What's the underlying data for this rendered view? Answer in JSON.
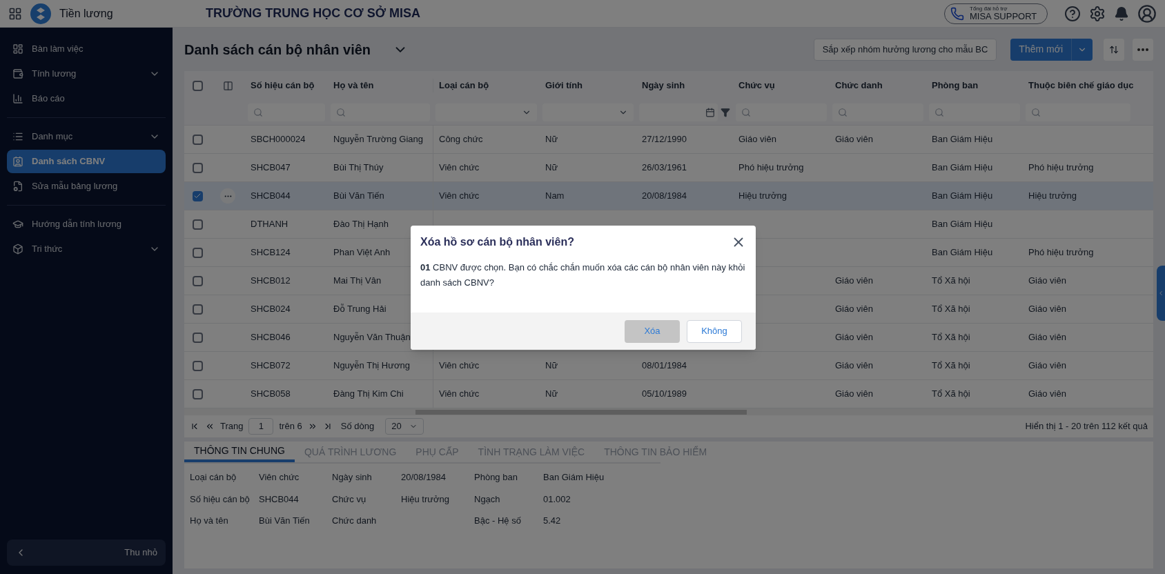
{
  "app": {
    "name": "Tiền lương",
    "school": "TRƯỜNG TRUNG HỌC CƠ SỞ MISA",
    "support_caption": "Tổng đài hỗ trợ",
    "support_label": "MISA SUPPORT"
  },
  "sidebar": {
    "groups": [
      [
        {
          "label": "Bàn làm việc",
          "selected": false,
          "expandable": false
        },
        {
          "label": "Tính lương",
          "selected": false,
          "expandable": true
        },
        {
          "label": "Báo cáo",
          "selected": false,
          "expandable": false
        }
      ],
      [
        {
          "label": "Danh mục",
          "selected": false,
          "expandable": true
        },
        {
          "label": "Danh sách CBNV",
          "selected": true,
          "expandable": false
        },
        {
          "label": "Sửa mẫu bảng lương",
          "selected": false,
          "expandable": false
        }
      ],
      [
        {
          "label": "Hướng dẫn tính lương",
          "selected": false,
          "expandable": false
        },
        {
          "label": "Tri thức",
          "selected": false,
          "expandable": true
        }
      ]
    ],
    "collapse_label": "Thu nhỏ"
  },
  "page": {
    "title": "Danh sách cán bộ nhân viên",
    "sort_button": "Sắp xếp nhóm hưởng lương cho mẫu BC",
    "add_button": "Thêm mới"
  },
  "table": {
    "all_selected": false,
    "columns": [
      {
        "label": "Số hiệu cán bộ",
        "kind": "search"
      },
      {
        "label": "Họ và tên",
        "kind": "search"
      },
      {
        "label": "Loại cán bộ",
        "kind": "select"
      },
      {
        "label": "Giới tính",
        "kind": "select"
      },
      {
        "label": "Ngày sinh",
        "kind": "date"
      },
      {
        "label": "Chức vụ",
        "kind": "search"
      },
      {
        "label": "Chức danh",
        "kind": "search"
      },
      {
        "label": "Phòng ban",
        "kind": "search"
      },
      {
        "label": "Thuộc biên chế giáo dục",
        "kind": "search"
      }
    ],
    "rows": [
      {
        "selected": false,
        "cells": [
          "SBCH000024",
          "Nguyễn Trường Giang",
          "Công chức",
          "Nữ",
          "27/12/1990",
          "Giáo viên",
          "Giáo viên",
          "Ban Giám Hiệu",
          null
        ]
      },
      {
        "selected": false,
        "cells": [
          "SHCB047",
          "Bùi Thị Thúy",
          "Viên chức",
          "Nữ",
          "26/03/1961",
          "Phó hiệu trưởng",
          null,
          "Ban Giám Hiệu",
          "Phó hiệu trưởng"
        ]
      },
      {
        "selected": true,
        "cells": [
          "SHCB044",
          "Bùi Văn Tiến",
          "Viên chức",
          "Nam",
          "20/08/1984",
          "Hiệu trưởng",
          null,
          "Ban Giám Hiệu",
          "Hiệu trưởng"
        ]
      },
      {
        "selected": false,
        "cells": [
          "DTHANH",
          "Đào Thị Hạnh",
          null,
          null,
          null,
          null,
          null,
          "Ban Giám Hiệu",
          null
        ]
      },
      {
        "selected": false,
        "cells": [
          "SHCB124",
          "Phan Việt Anh",
          null,
          null,
          null,
          null,
          null,
          "Ban Giám Hiệu",
          "Phó hiệu trưởng"
        ]
      },
      {
        "selected": false,
        "cells": [
          "SHCB012",
          "Mai Thị Vân",
          null,
          null,
          null,
          null,
          "Giáo viên",
          "Tổ Xã hội",
          "Giáo viên"
        ]
      },
      {
        "selected": false,
        "cells": [
          "SHCB024",
          "Đỗ Trung Hải",
          null,
          null,
          null,
          null,
          "Giáo viên",
          "Tổ Xã hội",
          "Giáo viên"
        ]
      },
      {
        "selected": false,
        "cells": [
          "SHCB046",
          "Nguyễn Văn Thuận",
          null,
          null,
          null,
          null,
          "Giáo viên",
          "Tổ Xã hội",
          "Giáo viên"
        ]
      },
      {
        "selected": false,
        "cells": [
          "SHCB072",
          "Nguyễn Thị Hương",
          "Viên chức",
          "Nữ",
          "08/01/1984",
          null,
          "Giáo viên",
          "Tổ Xã hội",
          "Giáo viên"
        ]
      },
      {
        "selected": false,
        "cells": [
          "SHCB058",
          "Đàng Thị Kim Chi",
          "Viên chức",
          "Nữ",
          "05/10/1989",
          null,
          "Giáo viên",
          "Tổ Xã hội",
          "Giáo viên"
        ]
      }
    ]
  },
  "pagination": {
    "page_label": "Trang",
    "page": "1",
    "of_pages": "trên 6",
    "rows_label": "Số dòng",
    "rows_per_page": "20",
    "summary": "Hiển thị 1 - 20 trên 112 kết quả"
  },
  "detail_tabs": [
    {
      "label": "THÔNG TIN CHUNG",
      "selected": true
    },
    {
      "label": "QUÁ TRÌNH LƯƠNG",
      "selected": false
    },
    {
      "label": "PHỤ CẤP",
      "selected": false
    },
    {
      "label": "TÌNH TRẠNG LÀM VIỆC",
      "selected": false
    },
    {
      "label": "THÔNG TIN BẢO HIỂM",
      "selected": false
    }
  ],
  "details": [
    [
      {
        "label": "Loại cán bộ",
        "value": "Viên chức"
      },
      {
        "label": "Ngày sinh",
        "value": "20/08/1984"
      },
      {
        "label": "Phòng ban",
        "value": "Ban Giám Hiệu"
      }
    ],
    [
      {
        "label": "Số hiệu cán bộ",
        "value": "SHCB044"
      },
      {
        "label": "Chức vụ",
        "value": "Hiệu trưởng"
      },
      {
        "label": "Ngạch",
        "value": "01.002"
      }
    ],
    [
      {
        "label": "Họ và tên",
        "value": "Bùi Văn Tiến"
      },
      {
        "label": "Chức danh"
      },
      {
        "label": "Bậc - Hệ số",
        "value": "5.42"
      }
    ]
  ],
  "dialog": {
    "title": "Xóa hồ sơ cán bộ nhân viên?",
    "message": "**01** CBNV được chọn. Bạn có chắc chắn muốn xóa các cán bộ nhân viên này khỏi danh sách CBNV?",
    "buttons": [
      {
        "label": "Xóa",
        "disabled": true
      },
      {
        "label": "Không",
        "disabled": false
      }
    ]
  }
}
